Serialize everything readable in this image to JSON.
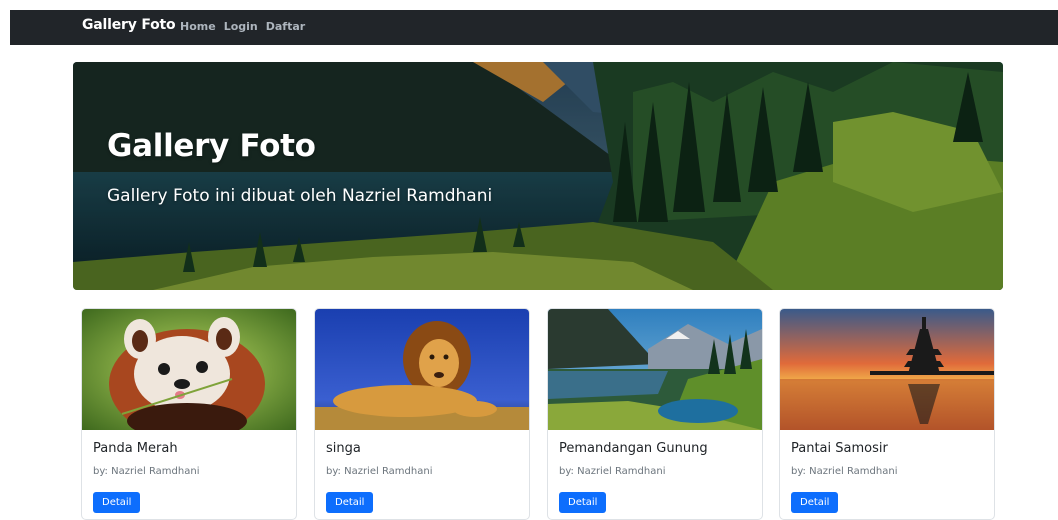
{
  "navbar": {
    "brand": "Gallery Foto",
    "links": [
      "Home",
      "Login",
      "Daftar"
    ]
  },
  "hero": {
    "title": "Gallery Foto",
    "subtitle": "Gallery Foto ini dibuat oleh Nazriel Ramdhani"
  },
  "cards": [
    {
      "title": "Panda Merah",
      "author": "by: Nazriel Ramdhani",
      "button": "Detail"
    },
    {
      "title": "singa",
      "author": "by: Nazriel Ramdhani",
      "button": "Detail"
    },
    {
      "title": "Pemandangan Gunung",
      "author": "by: Nazriel Ramdhani",
      "button": "Detail"
    },
    {
      "title": "Pantai Samosir",
      "author": "by: Nazriel Ramdhani",
      "button": "Detail"
    }
  ],
  "colors": {
    "navbar_bg": "#212529",
    "primary_button": "#0d6efd"
  }
}
